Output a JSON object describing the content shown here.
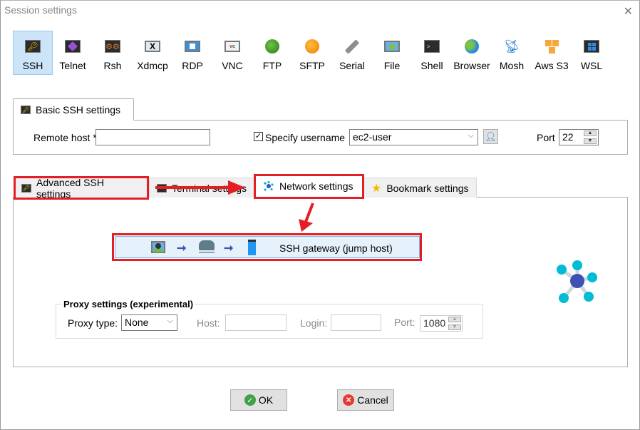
{
  "window": {
    "title": "Session settings",
    "close_icon": "close-icon"
  },
  "toolbar": {
    "items": [
      {
        "label": "SSH",
        "icon": "ssh-key-icon",
        "active": true
      },
      {
        "label": "Telnet",
        "icon": "telnet-icon"
      },
      {
        "label": "Rsh",
        "icon": "rsh-gears-icon"
      },
      {
        "label": "Xdmcp",
        "icon": "xdmcp-icon"
      },
      {
        "label": "RDP",
        "icon": "rdp-windows-icon"
      },
      {
        "label": "VNC",
        "icon": "vnc-icon"
      },
      {
        "label": "FTP",
        "icon": "ftp-globe-icon"
      },
      {
        "label": "SFTP",
        "icon": "sftp-globe-icon"
      },
      {
        "label": "Serial",
        "icon": "serial-plug-icon"
      },
      {
        "label": "File",
        "icon": "file-monitor-icon"
      },
      {
        "label": "Shell",
        "icon": "shell-terminal-icon"
      },
      {
        "label": "Browser",
        "icon": "browser-globe-icon"
      },
      {
        "label": "Mosh",
        "icon": "mosh-satellite-icon"
      },
      {
        "label": "Aws S3",
        "icon": "aws-s3-cubes-icon"
      },
      {
        "label": "WSL",
        "icon": "wsl-windows-icon"
      }
    ]
  },
  "basic": {
    "tab_label": "Basic SSH settings",
    "remote_host_label": "Remote host *",
    "remote_host_value": "",
    "specify_username_label": "Specify username",
    "specify_username_checked": true,
    "username_value": "ec2-user",
    "port_label": "Port",
    "port_value": "22"
  },
  "tabs": [
    {
      "label": "Advanced SSH settings",
      "icon": "key-icon"
    },
    {
      "label": "Terminal settings",
      "icon": "terminal-icon"
    },
    {
      "label": "Network settings",
      "icon": "network-icon",
      "active": true
    },
    {
      "label": "Bookmark settings",
      "icon": "star-icon"
    }
  ],
  "network": {
    "gateway_button_label": "SSH gateway (jump host)",
    "proxy": {
      "group_label": "Proxy settings (experimental)",
      "type_label": "Proxy type:",
      "type_value": "None",
      "host_label": "Host:",
      "host_value": "",
      "login_label": "Login:",
      "login_value": "",
      "port_label": "Port:",
      "port_value": "1080"
    }
  },
  "footer": {
    "ok_label": "OK",
    "cancel_label": "Cancel"
  },
  "colors": {
    "annotation_red": "#e31e24",
    "active_tool": "#cce4f7",
    "gateway_bg": "#e5f1fb"
  }
}
